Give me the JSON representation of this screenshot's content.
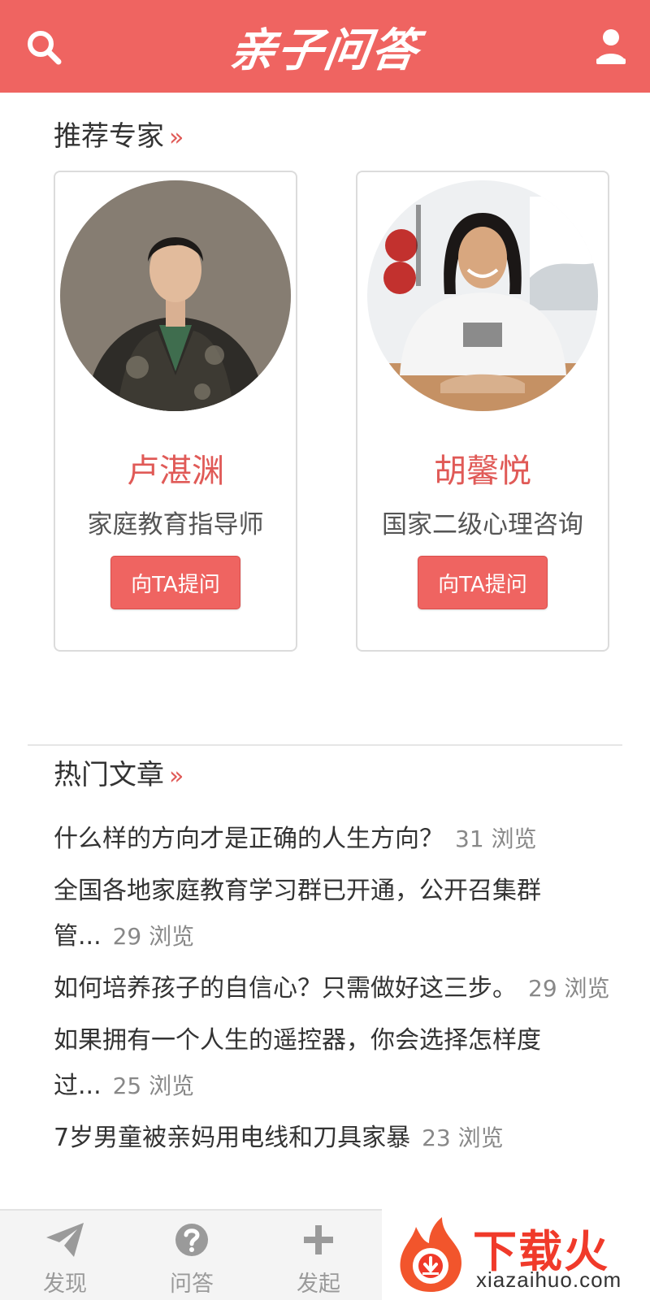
{
  "header": {
    "logo_text": "亲子问答",
    "icons": {
      "search": "search-icon",
      "user": "user-icon"
    },
    "accent_color": "#ef6461"
  },
  "experts_section": {
    "title": "推荐专家",
    "more": "»",
    "experts": [
      {
        "name": "卢湛渊",
        "title": "家庭教育指导师",
        "button": "向TA提问"
      },
      {
        "name": "胡馨悦",
        "title": "国家二级心理咨询",
        "button": "向TA提问"
      }
    ]
  },
  "articles_section": {
    "title": "热门文章",
    "more": "»",
    "articles": [
      {
        "title": "什么样的方向才是正确的人生方向？",
        "views": "31 浏览"
      },
      {
        "title": "全国各地家庭教育学习群已开通，公开召集群管...",
        "views": "29 浏览"
      },
      {
        "title": "如何培养孩子的自信心？只需做好这三步。",
        "views": "29 浏览"
      },
      {
        "title": "如果拥有一个人生的遥控器，你会选择怎样度过...",
        "views": "25 浏览"
      },
      {
        "title": "7岁男童被亲妈用电线和刀具家暴",
        "views": "23 浏览"
      }
    ]
  },
  "bottom_nav": {
    "items": [
      {
        "label": "发现",
        "icon": "paper-plane-icon"
      },
      {
        "label": "问答",
        "icon": "question-circle-icon"
      },
      {
        "label": "发起",
        "icon": "plus-icon"
      }
    ]
  },
  "watermark": {
    "brand": "下载火",
    "domain": "xiazaihuo.com"
  }
}
